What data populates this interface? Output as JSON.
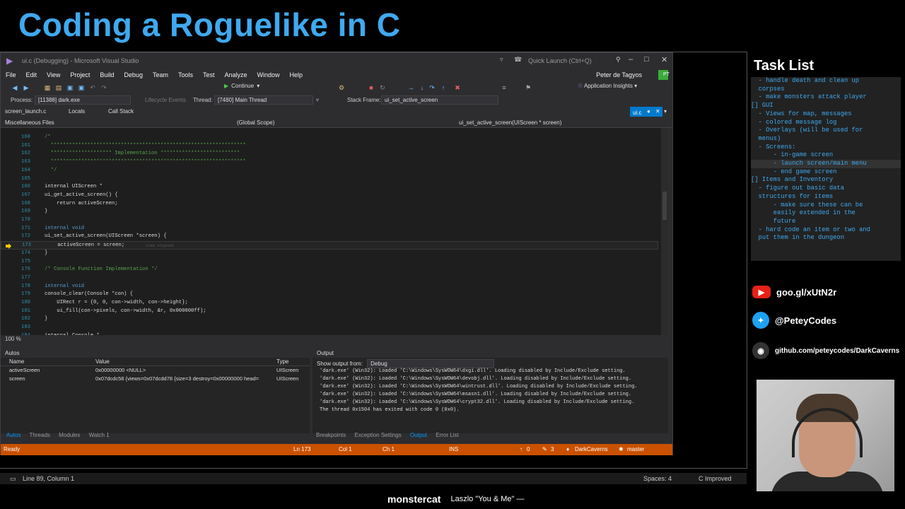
{
  "stream": {
    "title": "Coding a Roguelike in C"
  },
  "window": {
    "title": "ui.c (Debugging) - Microsoft Visual Studio",
    "quick_launch": "Quick Launch (Ctrl+Q)",
    "user": "Peter de Tagyos",
    "user_initials": "PT"
  },
  "menu": [
    "File",
    "Edit",
    "View",
    "Project",
    "Build",
    "Debug",
    "Team",
    "Tools",
    "Test",
    "Analyze",
    "Window",
    "Help"
  ],
  "toolbar": {
    "continue_label": "Continue",
    "app_insights": "Application Insights"
  },
  "debug_location": {
    "process_label": "Process:",
    "process_value": "[11388] dark.exe",
    "lifecycle": "Lifecycle Events",
    "thread_label": "Thread:",
    "thread_value": "[7480] Main Thread",
    "stack_label": "Stack Frame:",
    "stack_value": "ui_set_active_screen"
  },
  "tabs": {
    "screen_launch": "screen_launch.c",
    "locals": "Locals",
    "call_stack": "Call Stack",
    "active": "ui.c"
  },
  "navbar": {
    "project": "Miscellaneous Files",
    "scope": "(Global Scope)",
    "member": "ui_set_active_screen(UIScreen * screen)"
  },
  "code": [
    {
      "n": "160",
      "t": "/*",
      "k": "com"
    },
    {
      "n": "161",
      "t": "  ****************************************************************",
      "k": "com"
    },
    {
      "n": "162",
      "t": "  ******************** Implementation **************************",
      "k": "com"
    },
    {
      "n": "163",
      "t": "  ****************************************************************",
      "k": "com"
    },
    {
      "n": "164",
      "t": "  */",
      "k": "com"
    },
    {
      "n": "165",
      "t": "",
      "k": "def"
    },
    {
      "n": "166",
      "t": "internal UIScreen *",
      "k": "def"
    },
    {
      "n": "167",
      "t": "ui_get_active_screen() {",
      "k": "def"
    },
    {
      "n": "168",
      "t": "    return activeScreen;",
      "k": "def"
    },
    {
      "n": "169",
      "t": "}",
      "k": "def"
    },
    {
      "n": "170",
      "t": "",
      "k": "def"
    },
    {
      "n": "171",
      "t": "internal void",
      "k": "kw"
    },
    {
      "n": "172",
      "t": "ui_set_active_screen(UIScreen *screen) {",
      "k": "def"
    },
    {
      "n": "173",
      "t": "    activeScreen = screen;",
      "k": "def",
      "cur": true,
      "elapsed": "≤1ms elapsed"
    },
    {
      "n": "174",
      "t": "}",
      "k": "def"
    },
    {
      "n": "175",
      "t": "",
      "k": "def"
    },
    {
      "n": "176",
      "t": "/* Console Function Implementation */",
      "k": "com"
    },
    {
      "n": "177",
      "t": "",
      "k": "def"
    },
    {
      "n": "178",
      "t": "internal void",
      "k": "kw"
    },
    {
      "n": "179",
      "t": "console_clear(Console *con) {",
      "k": "def"
    },
    {
      "n": "180",
      "t": "    UIRect r = {0, 0, con->width, con->height};",
      "k": "def"
    },
    {
      "n": "181",
      "t": "    ui_fill(con->pixels, con->width, &r, 0x000000ff);",
      "k": "def"
    },
    {
      "n": "182",
      "t": "}",
      "k": "def"
    },
    {
      "n": "183",
      "t": "",
      "k": "def"
    },
    {
      "n": "184",
      "t": "internal Console *",
      "k": "def"
    }
  ],
  "zoom": "100 %",
  "autos": {
    "title": "Autos",
    "headers": [
      "Name",
      "Value",
      "Type"
    ],
    "rows": [
      {
        "name": "activeScreen",
        "value": "0x00000000 <NULL>",
        "type": "UIScreen"
      },
      {
        "name": "screen",
        "value": "0x07dcdc58 {views=0x07dcdd78 {size=3 destroy=0x00000000 head=",
        "type": "UIScreen"
      }
    ],
    "tabs": [
      "Autos",
      "Threads",
      "Modules",
      "Watch 1"
    ]
  },
  "output": {
    "title": "Output",
    "source_label": "Show output from:",
    "source_value": "Debug",
    "lines": [
      "'dark.exe' (Win32): Loaded 'C:\\Windows\\SysWOW64\\dxgi.dll'. Loading disabled by Include/Exclude setting.",
      "'dark.exe' (Win32): Loaded 'C:\\Windows\\SysWOW64\\devobj.dll'. Loading disabled by Include/Exclude setting.",
      "'dark.exe' (Win32): Loaded 'C:\\Windows\\SysWOW64\\wintrust.dll'. Loading disabled by Include/Exclude setting.",
      "'dark.exe' (Win32): Loaded 'C:\\Windows\\SysWOW64\\msasn1.dll'. Loading disabled by Include/Exclude setting.",
      "'dark.exe' (Win32): Loaded 'C:\\Windows\\SysWOW64\\crypt32.dll'. Loading disabled by Include/Exclude setting.",
      "The thread 0x1504 has exited with code 0 (0x0)."
    ],
    "tabs": [
      "Breakpoints",
      "Exception Settings",
      "Output",
      "Error List"
    ]
  },
  "status": {
    "ready": "Ready",
    "ln": "Ln 173",
    "col": "Col 1",
    "ch": "Ch 1",
    "ins": "INS",
    "up": "0",
    "pencil": "3",
    "repo": "DarkCaverns",
    "branch": "master"
  },
  "host_status": {
    "position": "Line 89, Column 1",
    "spaces": "Spaces: 4",
    "lang": "C Improved"
  },
  "tasklist": {
    "title": "Task List",
    "lines": [
      "  - handle death and clean up",
      "  corpses",
      "  - make monsters attack player",
      "",
      "[] GUI",
      "  - Views for map, messages",
      "  - colored message log",
      "  - Overlays (will be used for",
      "  menus)",
      "  - Screens:",
      "      - in-game screen",
      "      - launch screen/main menu",
      "      - end game screen",
      "",
      "[] Items and Inventory",
      "  - figure out basic data",
      "  structures for items",
      "      - make sure these can be",
      "      easily extended in the",
      "      future",
      "  - hard code an item or two and",
      "  put them in the dungeon"
    ]
  },
  "social": {
    "youtube": "goo.gl/xUtN2r",
    "twitter": "@PeteyCodes",
    "github": "github.com/peteycodes/DarkCaverns"
  },
  "now_playing": {
    "label": "monstercat",
    "track": "Laszlo \"You & Me\" —"
  }
}
